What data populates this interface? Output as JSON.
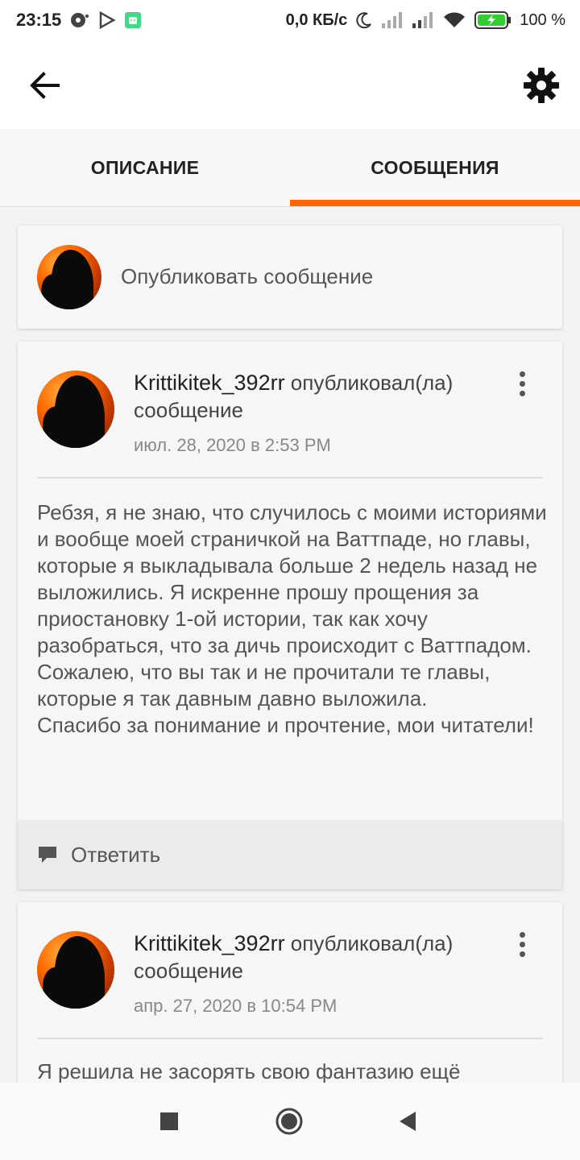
{
  "status_bar": {
    "time": "23:15",
    "network_speed": "0,0 КБ/с",
    "battery_percent": "100 %",
    "icons": [
      "media-icon",
      "play-store-icon",
      "android-icon",
      "moon-icon",
      "signal-icon",
      "signal-icon",
      "wifi-icon",
      "battery-charging-icon"
    ]
  },
  "top_bar": {
    "back_icon": "arrow-left-icon",
    "settings_icon": "gear-icon"
  },
  "tabs": [
    {
      "label": "ОПИСАНИЕ",
      "active": false
    },
    {
      "label": "СООБЩЕНИЯ",
      "active": true
    }
  ],
  "accent_color": "#ff6600",
  "post_prompt": "Опубликовать сообщение",
  "messages": [
    {
      "username": "Krittikitek_392rr",
      "action": " опубликовал(ла) сообщение",
      "date": "июл. 28, 2020 в 2:53 PM",
      "body": [
        "Ребзя, я не знаю, что случилось с моими историями и вообще моей страничкой на Ваттпаде, но главы, которые я выкладывала больше 2 недель назад не выложились. Я искренне прошу прощения за приостановку 1-ой истории, так как хочу разобраться, что за дичь происходит с Ваттпадом.",
        "Сожалею, что вы так и не прочитали те главы, которые я так давным давно выложила.",
        "Спасибо за понимание и прочтение, мои читатели!"
      ],
      "reply_label": "Ответить"
    },
    {
      "username": "Krittikitek_392rr",
      "action": " опубликовал(ла) сообщение",
      "date": "апр. 27, 2020 в 10:54 PM",
      "body_preview": "Я решила не засорять свою фантазию ещё"
    }
  ],
  "nav_bar": {
    "icons": [
      "recent-apps-icon",
      "home-icon",
      "back-triangle-icon"
    ]
  }
}
